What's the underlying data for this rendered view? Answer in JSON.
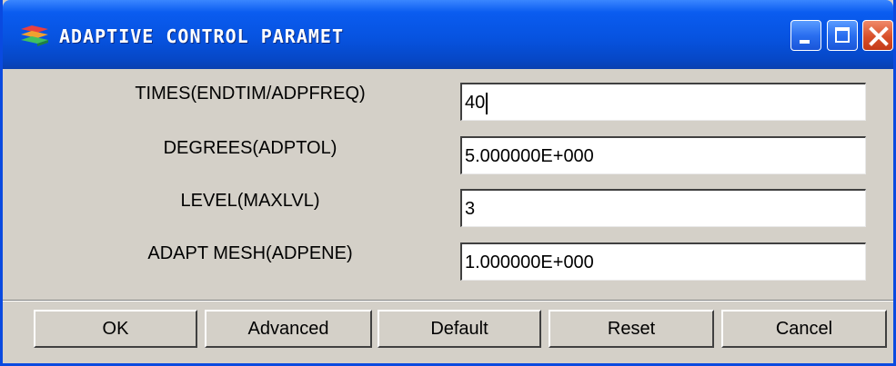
{
  "window": {
    "title": "ADAPTIVE CONTROL PARAMET",
    "titlebar_color": "#0753e0",
    "background_color": "#d4d0c8",
    "controls": [
      {
        "name": "minimize",
        "icon": "minimize-icon"
      },
      {
        "name": "maximize",
        "icon": "maximize-icon"
      },
      {
        "name": "close",
        "icon": "close-icon"
      }
    ]
  },
  "form": {
    "fields": [
      {
        "label": "TIMES(ENDTIM/ADPFREQ)",
        "value": "40",
        "focused": true
      },
      {
        "label": "DEGREES(ADPTOL)",
        "value": "5.000000E+000",
        "focused": false
      },
      {
        "label": "LEVEL(MAXLVL)",
        "value": "3",
        "focused": false
      },
      {
        "label": "ADAPT MESH(ADPENE)",
        "value": "1.000000E+000",
        "focused": false
      }
    ]
  },
  "buttons": {
    "ok": "OK",
    "advanced": "Advanced",
    "default": "Default",
    "reset": "Reset",
    "cancel": "Cancel"
  }
}
